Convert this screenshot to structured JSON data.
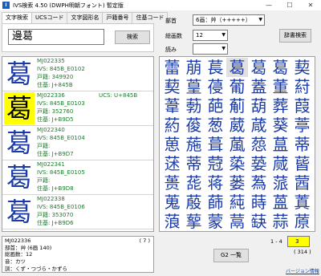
{
  "window": {
    "title": "IVS検索 4.50 (DWPH明朝フォント) 暫定版",
    "icon": "app-icon",
    "buttons": [
      "—",
      "☐",
      "✕"
    ]
  },
  "tabs": [
    "文字検索",
    "UCSコード",
    "文字図形名",
    "戸籍番号",
    "住基コード"
  ],
  "search": {
    "value": "邊葛",
    "button": "検索"
  },
  "filters": {
    "radical_label": "部首",
    "radical_value": "6画：艸（+++++）",
    "strokes_label": "総画数",
    "strokes_value": "12",
    "reading_label": "読み",
    "reading_value": "",
    "dict_button": "辞書検索"
  },
  "results": [
    {
      "glyph": "葛",
      "lines": [
        "MJ022335",
        "IVS: 845B_E0102",
        "戸籍: 349920",
        "住基: J+845B"
      ],
      "ucs": "",
      "selected": false
    },
    {
      "glyph": "葛",
      "lines": [
        "MJ022336",
        "IVS: 845B_E0103",
        "戸籍: 352760",
        "住基: J+B9D5"
      ],
      "ucs": "UCS: U+845B",
      "selected": true
    },
    {
      "glyph": "葛",
      "lines": [
        "MJ022340",
        "IVS: 845B_E0104",
        "戸籍: ",
        "住基: J+B9D7"
      ],
      "ucs": "",
      "selected": false
    },
    {
      "glyph": "葛",
      "lines": [
        "MJ022341",
        "IVS: 845B_E0105",
        "戸籍: ",
        "住基: J+B9D8"
      ],
      "ucs": "",
      "selected": false
    },
    {
      "glyph": "葛",
      "lines": [
        "MJ022338",
        "IVS: 845B_E0106",
        "戸籍: 353070",
        "住基: J+B9D6"
      ],
      "ucs": "",
      "selected": false
    }
  ],
  "grid": [
    "蕾",
    "萠",
    "萇",
    "葛",
    "葛",
    "葛",
    "葜",
    "葜",
    "葟",
    "葠",
    "葡",
    "蓋",
    "董",
    "葤",
    "葦",
    "葧",
    "葩",
    "葪",
    "葫",
    "葬",
    "葭",
    "葯",
    "葰",
    "葱",
    "葳",
    "葴",
    "葵",
    "葶",
    "葸",
    "葹",
    "葺",
    "葻",
    "葾",
    "蒀",
    "蒂",
    "蒁",
    "蒂",
    "蒄",
    "蒅",
    "蒆",
    "蒇",
    "蒈",
    "蒉",
    "蒊",
    "蒋",
    "蒌",
    "蒍",
    "蒎",
    "蒏",
    "蒐",
    "蒑",
    "蒒",
    "蒓",
    "蒔",
    "蒕",
    "蒖",
    "蒗",
    "蒘",
    "蒙",
    "蒚",
    "蒛",
    "蒜",
    "蒝"
  ],
  "info": {
    "mj": "MJ022336",
    "count": "( 7 )",
    "radical": "部首：艸 (6画 140)",
    "strokes": "総画数：12",
    "on": "音：カツ",
    "kun": "訓：くず・つづら・かずら"
  },
  "pager": {
    "range": "1 - 4",
    "page": "3",
    "total": "( 314 )",
    "g2_button": "G2 一覧"
  },
  "version_link": "バージョン情報"
}
